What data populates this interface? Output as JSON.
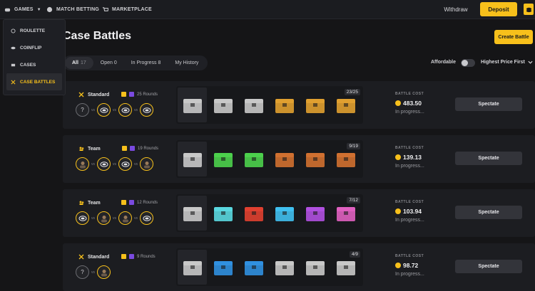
{
  "nav": {
    "games": "GAMES",
    "match_betting": "MATCH BETTING",
    "marketplace": "MARKETPLACE",
    "withdraw": "Withdraw",
    "deposit": "Deposit"
  },
  "dropdown": [
    {
      "label": "ROULETTE",
      "icon": "roulette-icon",
      "active": false
    },
    {
      "label": "COINFLIP",
      "icon": "coinflip-icon",
      "active": false
    },
    {
      "label": "CASES",
      "icon": "cases-icon",
      "active": false
    },
    {
      "label": "CASE BATTLES",
      "icon": "swords-icon",
      "active": true
    }
  ],
  "page": {
    "title": "Case Battles",
    "create_button": "Create Battle"
  },
  "tabs": [
    {
      "label": "All",
      "count": "17",
      "active": true
    },
    {
      "label": "Open 0",
      "count": "",
      "active": false
    },
    {
      "label": "In Progress 8",
      "count": "",
      "active": false
    },
    {
      "label": "My History",
      "count": "",
      "active": false
    }
  ],
  "filters": {
    "affordable": "Affordable",
    "affordable_on": false,
    "sort": "Highest Price First"
  },
  "battles": [
    {
      "mode": "Standard",
      "rounds": "25 Rounds",
      "round_progress": "23/25",
      "cost_label": "BATTLE COST",
      "cost": "483.50",
      "status": "In progress...",
      "action": "Spectate",
      "players": [
        "?",
        "coin",
        "coin",
        "coin"
      ],
      "cases": [
        "#c8c8c8",
        "#c8c8c8",
        "#c8c8c8",
        "#e0a030",
        "#e0a030",
        "#e0a030"
      ]
    },
    {
      "mode": "Team",
      "rounds": "19 Rounds",
      "round_progress": "9/19",
      "cost_label": "BATTLE COST",
      "cost": "139.13",
      "status": "In progress...",
      "action": "Spectate",
      "players": [
        "avatar",
        "coin",
        "coin",
        "avatar"
      ],
      "cases": [
        "#c8c8c8",
        "#4cd04c",
        "#4cd04c",
        "#d07030",
        "#d07030",
        "#d07030"
      ]
    },
    {
      "mode": "Team",
      "rounds": "12 Rounds",
      "round_progress": "7/12",
      "cost_label": "BATTLE COST",
      "cost": "103.94",
      "status": "In progress...",
      "action": "Spectate",
      "players": [
        "coin",
        "avatar",
        "avatar",
        "coin"
      ],
      "cases": [
        "#c8c8c8",
        "#5ad8e0",
        "#e04030",
        "#40c0f0",
        "#b050e0",
        "#e060c0"
      ]
    },
    {
      "mode": "Standard",
      "rounds": "9 Rounds",
      "round_progress": "4/9",
      "cost_label": "BATTLE COST",
      "cost": "98.72",
      "status": "In progress...",
      "action": "Spectate",
      "players": [
        "?",
        "avatar"
      ],
      "cases": [
        "#c8c8c8",
        "#3090e0",
        "#3090e0",
        "#c8c8c8",
        "#c8c8c8",
        "#c8c8c8"
      ]
    }
  ]
}
